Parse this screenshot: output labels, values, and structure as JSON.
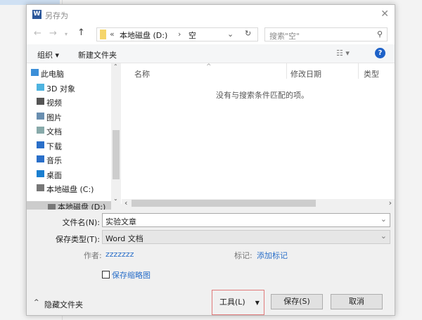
{
  "title": "另存为",
  "address": {
    "prefix": "«",
    "path": [
      "本地磁盘 (D:)",
      "空"
    ]
  },
  "search": {
    "placeholder": "搜索\"空\""
  },
  "toolbar": {
    "organize": "组织 ▾",
    "new_folder": "新建文件夹"
  },
  "nav": [
    {
      "label": "此电脑",
      "icon": "computer-icon",
      "color": "#3c8fd8"
    },
    {
      "label": "3D 对象",
      "icon": "cube-icon",
      "color": "#4fb4e0"
    },
    {
      "label": "视频",
      "icon": "video-icon",
      "color": "#555"
    },
    {
      "label": "图片",
      "icon": "picture-icon",
      "color": "#6a8fb0"
    },
    {
      "label": "文档",
      "icon": "document-icon",
      "color": "#8aa"
    },
    {
      "label": "下载",
      "icon": "download-icon",
      "color": "#2a6fc9"
    },
    {
      "label": "音乐",
      "icon": "music-icon",
      "color": "#2a6fc9"
    },
    {
      "label": "桌面",
      "icon": "desktop-icon",
      "color": "#1a7fd0"
    },
    {
      "label": "本地磁盘 (C:)",
      "icon": "drive-icon",
      "color": "#777"
    },
    {
      "label": "本地磁盘 (D:)",
      "icon": "drive-icon",
      "color": "#777"
    }
  ],
  "columns": [
    "名称",
    "修改日期",
    "类型"
  ],
  "empty": "没有与搜索条件匹配的项。",
  "form": {
    "filename_label": "文件名(N):",
    "filename": "实验文章",
    "type_label": "保存类型(T):",
    "type": "Word 文档",
    "author_label": "作者:",
    "author": "zzzzzzz",
    "tags_label": "标记:",
    "tags": "添加标记",
    "thumb": "保存缩略图"
  },
  "buttons": {
    "hide": "隐藏文件夹",
    "tools": "工具(L)",
    "save": "保存(S)",
    "cancel": "取消"
  }
}
